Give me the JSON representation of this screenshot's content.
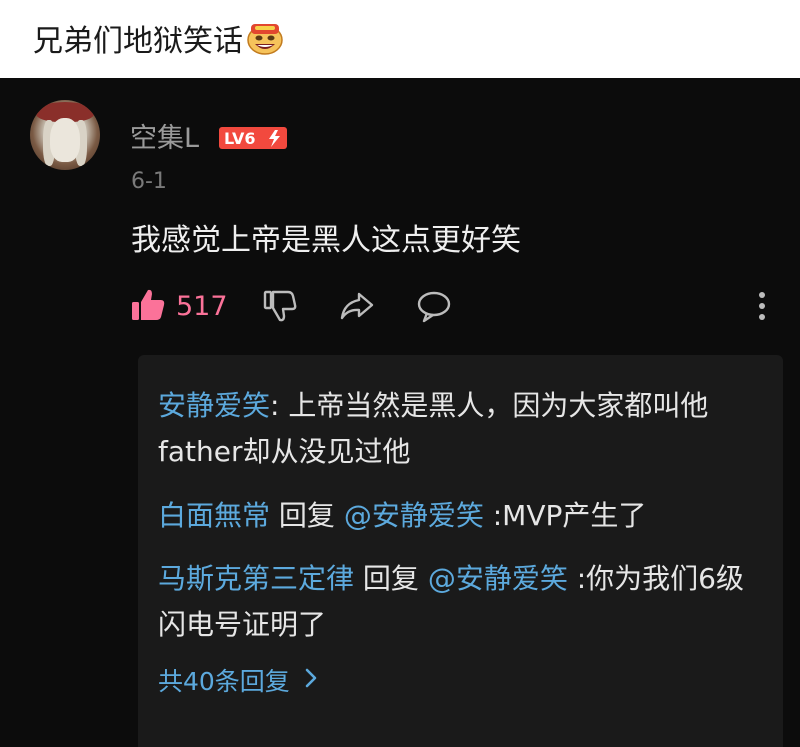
{
  "post": {
    "title": "兄弟们地狱笑话"
  },
  "comment": {
    "username": "空集L",
    "level": "LV6",
    "date": "6-1",
    "text": "我感觉上帝是黑人这点更好笑",
    "like_count": "517"
  },
  "replies": [
    {
      "author": "安静爱笑",
      "separator": ": ",
      "text": "上帝当然是黑人，因为大家都叫他father却从没见过他"
    },
    {
      "author": "白面無常",
      "reply_word": " 回复 ",
      "mention": "@安静爱笑",
      "text": " :MVP产生了"
    },
    {
      "author": "马斯克第三定律",
      "reply_word": " 回复 ",
      "mention": "@安静爱笑",
      "text": " :你为我们6级闪电号证明了"
    }
  ],
  "more_replies": {
    "label": "共40条回复"
  },
  "icons": {
    "title_emoji": "laughing-emoji-icon",
    "like": "thumbs-up-icon",
    "dislike": "thumbs-down-icon",
    "share": "share-icon",
    "comment": "comment-icon",
    "more": "more-vertical-icon",
    "chevron": "chevron-right-icon"
  },
  "colors": {
    "background": "#0c0c0c",
    "reply_panel": "#1a1a1a",
    "accent_pink": "#fb7299",
    "link_blue": "#5ca9dd",
    "level_badge": "#f2493e"
  }
}
